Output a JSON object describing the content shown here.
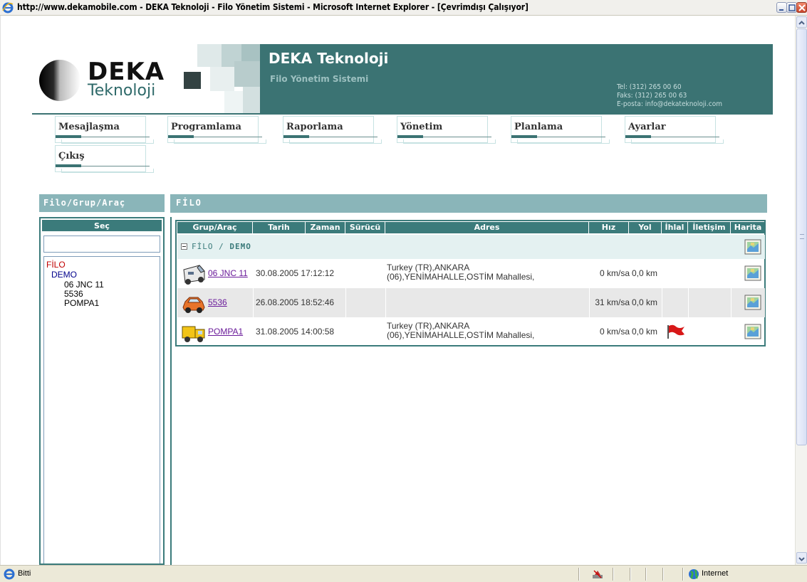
{
  "window": {
    "title": "http://www.dekamobile.com - DEKA Teknoloji - Filo Yönetim Sistemi - Microsoft Internet Explorer - [Çevrimdışı Çalışıyor]"
  },
  "header": {
    "logo_word_1": "DEKA",
    "logo_word_2": "Teknoloji",
    "company_name": "DEKA Teknoloji",
    "company_subtitle": "Filo Yönetim Sistemi",
    "contact": {
      "tel": "Tel: (312) 265 00 60",
      "fax": "Faks: (312) 265 00 63",
      "email": "E-posta: info@dekateknoloji.com"
    }
  },
  "nav": {
    "items": [
      "Mesajlaşma",
      "Programlama",
      "Raporlama",
      "Yönetim",
      "Planlama",
      "Ayarlar",
      "Çıkış"
    ]
  },
  "left_panel": {
    "title": "Filo/Grup/Araç",
    "select_label": "Seç",
    "search_value": "",
    "tree": {
      "root": "FİLO",
      "group": "DEMO",
      "vehicles": [
        "06 JNC 11",
        "5536",
        "POMPA1"
      ]
    }
  },
  "main": {
    "title": "FİLO",
    "columns": [
      "Grup/Araç",
      "Tarih",
      "Zaman",
      "Sürücü",
      "Adres",
      "Hız",
      "Yol",
      "İhlal",
      "İletişim",
      "Harita"
    ],
    "group_path": {
      "root": "FİLO",
      "separator": " / ",
      "group": "DEMO"
    },
    "rows": [
      {
        "vehicle": "06 JNC 11",
        "datetime": "30.08.2005 17:12:12",
        "address_line1": "Turkey (TR),ANKARA",
        "address_line2": "(06),YENİMAHALLE,OSTİM Mahallesi,",
        "speed": "0 km/sa",
        "distance": "0,0 km",
        "violation": false,
        "icon": "van-icon"
      },
      {
        "vehicle": "5536",
        "datetime": "26.08.2005 18:52:46",
        "address_line1": "",
        "address_line2": "",
        "speed": "31 km/sa",
        "distance": "0,0 km",
        "violation": false,
        "icon": "car-icon"
      },
      {
        "vehicle": "POMPA1",
        "datetime": "31.08.2005 14:00:58",
        "address_line1": "Turkey (TR),ANKARA",
        "address_line2": "(06),YENİMAHALLE,OSTİM Mahallesi,",
        "speed": "0 km/sa",
        "distance": "0,0 km",
        "violation": true,
        "icon": "truck-icon"
      }
    ]
  },
  "statusbar": {
    "status": "Bitti",
    "zone": "Internet"
  },
  "colors": {
    "brand_dark": "#3b7373",
    "panel_head": "#8ab5b9",
    "link": "#6a1b9a",
    "tree_root": "#c00000",
    "tree_group": "#00008b"
  }
}
